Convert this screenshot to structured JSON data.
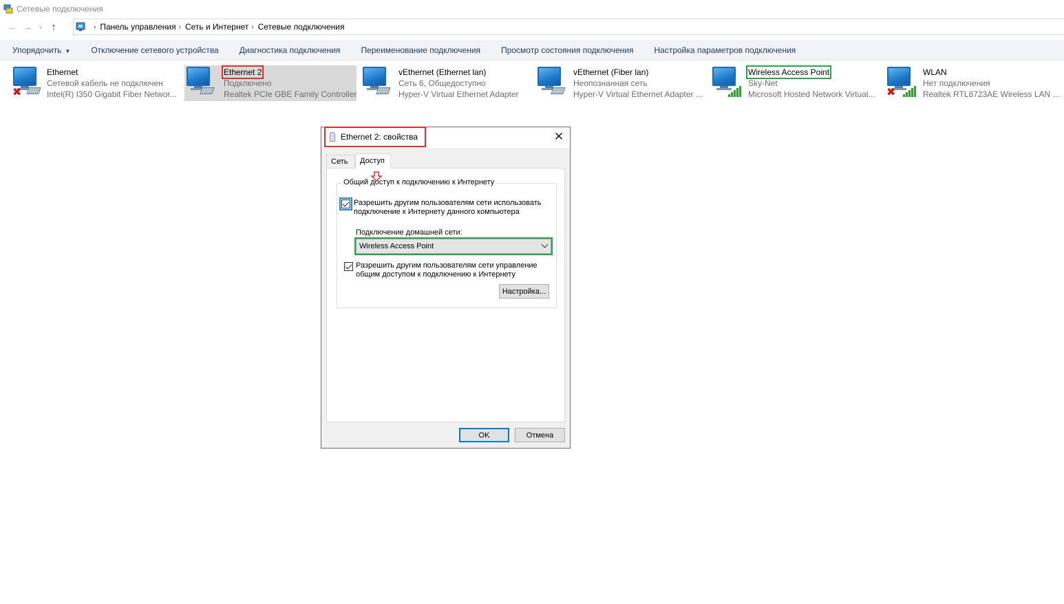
{
  "window": {
    "title": "Сетевые подключения"
  },
  "address": {
    "breadcrumbs": [
      "Панель управления",
      "Сеть и Интернет",
      "Сетевые подключения"
    ]
  },
  "commands": {
    "organize": "Упорядочить",
    "disable_device": "Отключение сетевого устройства",
    "diagnose": "Диагностика подключения",
    "rename": "Переименование подключения",
    "view_status": "Просмотр состояния подключения",
    "change_settings": "Настройка параметров подключения"
  },
  "connections": [
    {
      "name": "Ethernet",
      "status": "Сетевой кабель не подключен",
      "device": "Intel(R) I350 Gigabit Fiber Networ...",
      "icon": "wired-disconnected-icon"
    },
    {
      "name": "Ethernet 2",
      "status": "Подключено",
      "device": "Realtek PCIe GBE Family Controller",
      "icon": "wired-connected-icon"
    },
    {
      "name": "vEthernet (Ethernet lan)",
      "status": "Сеть  6, Общедоступно",
      "device": "Hyper-V Virtual Ethernet Adapter",
      "icon": "wired-connected-icon"
    },
    {
      "name": "vEthernet (Fiber lan)",
      "status": "Неопознанная сеть",
      "device": "Hyper-V Virtual Ethernet Adapter ...",
      "icon": "wired-connected-icon"
    },
    {
      "name": "Wireless Access Point",
      "status": "Sky-Net",
      "device": "Microsoft Hosted Network Virtual...",
      "icon": "wireless-connected-icon"
    },
    {
      "name": "WLAN",
      "status": "Нет подключения",
      "device": "Realtek RTL8723AE Wireless LAN ...",
      "icon": "wireless-disconnected-icon"
    }
  ],
  "dialog": {
    "title": "Ethernet 2: свойства",
    "tabs": [
      "Сеть",
      "Доступ"
    ],
    "active_tab": "Доступ",
    "group_title": "Общий доступ к подключению к Интернету",
    "allow_share_label": "Разрешить другим пользователям сети использовать подключение к Интернету данного компьютера",
    "allow_share_checked": true,
    "home_network_label": "Подключение домашней сети:",
    "home_network_value": "Wireless Access Point",
    "allow_control_label": "Разрешить другим пользователям сети управление общим доступом к подключению к Интернету",
    "allow_control_checked": true,
    "settings_button": "Настройка...",
    "ok_button": "OK",
    "cancel_button": "Отмена"
  },
  "colors": {
    "highlight_red": "#e02d2d",
    "highlight_green": "#22a84a",
    "highlight_blue": "#1a8fd6",
    "selected_bg": "#d9d9d9",
    "command_text": "#1e395b"
  }
}
